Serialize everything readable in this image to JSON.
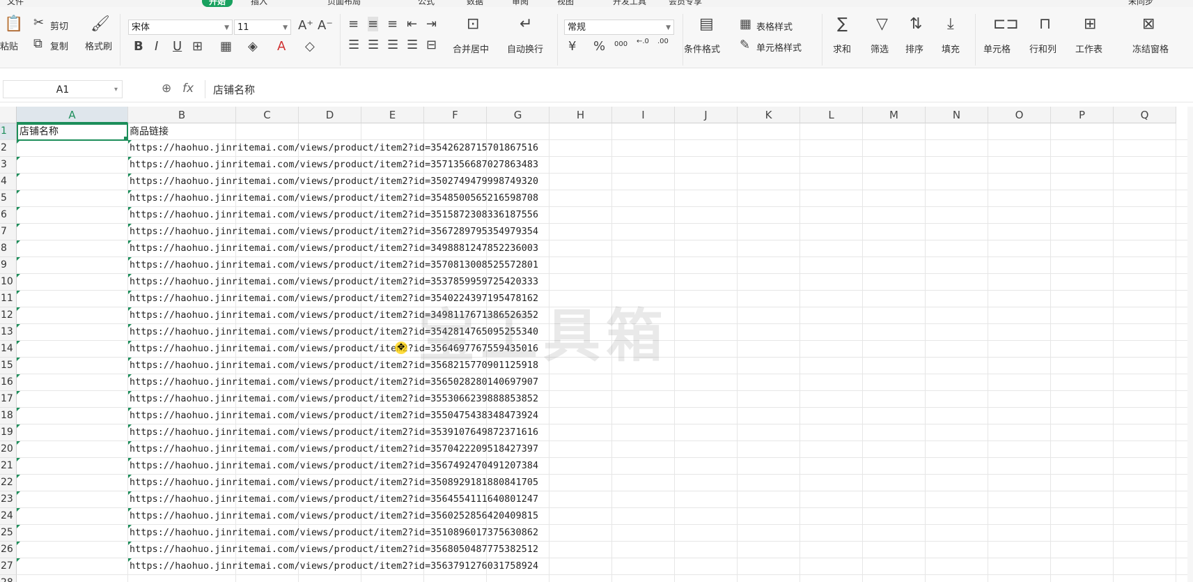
{
  "menu": {
    "tabs": [
      "文件",
      "开始",
      "插入",
      "页面布局",
      "公式",
      "数据",
      "审阅",
      "视图",
      "开发工具",
      "会员专享"
    ],
    "active_tab": "开始",
    "user": "未同步"
  },
  "ribbon": {
    "paste": "粘贴",
    "cut": "剪切",
    "copy": "复制",
    "format_painter": "格式刷",
    "font_name": "宋体",
    "font_size": "11",
    "merge_center": "合并居中",
    "wrap_text": "自动换行",
    "number_format": "常规",
    "currency": "¥",
    "percent": "%",
    "thousands": "000",
    "conditional_format": "条件格式",
    "table_style": "表格样式",
    "cell_style": "单元格样式",
    "sum": "求和",
    "filter": "筛选",
    "sort": "排序",
    "fill": "填充",
    "cell": "单元格",
    "rows_cols": "行和列",
    "worksheet": "工作表",
    "freeze": "冻结窗格"
  },
  "formula_bar": {
    "name_box": "A1",
    "fx": "fx",
    "value": "店铺名称"
  },
  "sheet": {
    "columns": [
      "A",
      "B",
      "C",
      "D",
      "E",
      "F",
      "G",
      "H",
      "I",
      "J",
      "K",
      "L",
      "M",
      "N",
      "O",
      "P",
      "Q"
    ],
    "header_row": {
      "A": "店铺名称",
      "B": "商品链接"
    },
    "rows": [
      "https://haohuo.jinritemai.com/views/product/item2?id=3542628715701867516",
      "https://haohuo.jinritemai.com/views/product/item2?id=3571356687027863483",
      "https://haohuo.jinritemai.com/views/product/item2?id=3502749479998749320",
      "https://haohuo.jinritemai.com/views/product/item2?id=3548500565216598708",
      "https://haohuo.jinritemai.com/views/product/item2?id=3515872308336187556",
      "https://haohuo.jinritemai.com/views/product/item2?id=3567289795354979354",
      "https://haohuo.jinritemai.com/views/product/item2?id=3498881247852236003",
      "https://haohuo.jinritemai.com/views/product/item2?id=3570813008525572801",
      "https://haohuo.jinritemai.com/views/product/item2?id=3537859959725420333",
      "https://haohuo.jinritemai.com/views/product/item2?id=3540224397195478162",
      "https://haohuo.jinritemai.com/views/product/item2?id=3498117671386526352",
      "https://haohuo.jinritemai.com/views/product/item2?id=3542814765095255340",
      "https://haohuo.jinritemai.com/views/product/item2?id=3564697767559435016",
      "https://haohuo.jinritemai.com/views/product/item2?id=3568215770901125918",
      "https://haohuo.jinritemai.com/views/product/item2?id=3565028280140697907",
      "https://haohuo.jinritemai.com/views/product/item2?id=3553066239888853852",
      "https://haohuo.jinritemai.com/views/product/item2?id=3550475438348473924",
      "https://haohuo.jinritemai.com/views/product/item2?id=3539107649872371616",
      "https://haohuo.jinritemai.com/views/product/item2?id=3570422209518427397",
      "https://haohuo.jinritemai.com/views/product/item2?id=3567492470491207384",
      "https://haohuo.jinritemai.com/views/product/item2?id=3508929181880841705",
      "https://haohuo.jinritemai.com/views/product/item2?id=3564554111640801247",
      "https://haohuo.jinritemai.com/views/product/item2?id=3560252856420409815",
      "https://haohuo.jinritemai.com/views/product/item2?id=3510896017375630862",
      "https://haohuo.jinritemai.com/views/product/item2?id=3568050487775382512",
      "https://haohuo.jinritemai.com/views/product/item2?id=3563791276031758924"
    ]
  },
  "watermark": "宝工具箱",
  "colors": {
    "accent": "#1c8e5a",
    "header_bg": "#f4f4f4",
    "gridline": "#e6e6e6"
  }
}
